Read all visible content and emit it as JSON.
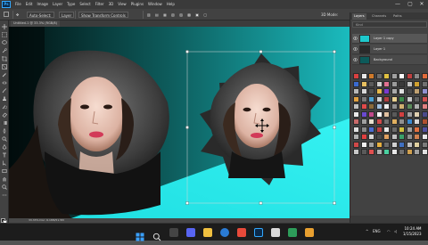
{
  "menubar": {
    "logo": "Ps",
    "items": [
      "File",
      "Edit",
      "Image",
      "Layer",
      "Type",
      "Select",
      "Filter",
      "3D",
      "View",
      "Plugins",
      "Window",
      "Help"
    ],
    "minimize": "—",
    "maximize": "▢",
    "close": "✕"
  },
  "options": {
    "auto_select": "Auto-Select:",
    "layer_value": "Layer",
    "show_transform": "Show Transform Controls",
    "mode_3d": "3D Mode:"
  },
  "document": {
    "tab_label": "Untitled-1 @ 33.3% (RGB/8)",
    "status_text": "33.33%   Doc: 6.18M/51.5M"
  },
  "panels": {
    "tabs": [
      "Layers",
      "Channels",
      "Paths"
    ],
    "search_placeholder": "Kind",
    "layers": [
      {
        "name": "Layer 1 copy"
      },
      {
        "name": "Layer 1"
      },
      {
        "name": "Background"
      }
    ]
  },
  "palette_colors": [
    "#d94040",
    "#e8e8e8",
    "#d07a2a",
    "#6a6a6a",
    "#e0c040",
    "#a0a0a0",
    "#ffffff",
    "#c04040",
    "#8a8a8a",
    "#e06a3a",
    "#3a6ad0",
    "#e8c060",
    "#5a5a5a",
    "#d0d0d0",
    "#e07090",
    "#9a9a9a",
    "#3a3a3a",
    "#c0c0c0",
    "#d0a030",
    "#707070",
    "#b8b8b8",
    "#d8d8d8",
    "#505050",
    "#e6b84a",
    "#7a3ad0",
    "#aaaaaa",
    "#e0e0e0",
    "#4a4a4a",
    "#c0a070",
    "#9090d0",
    "#e0a040",
    "#7a7a7a",
    "#4aa0d0",
    "#d0d0d0",
    "#b04040",
    "#e8d090",
    "#3a8a4a",
    "#c8c8c8",
    "#606060",
    "#d05050",
    "#c0c0c0",
    "#e04a4a",
    "#8a6a3a",
    "#a0c0e0",
    "#f0f0f0",
    "#909090",
    "#d0b070",
    "#5a8a5a",
    "#b0b0b0",
    "#e08080",
    "#e8e8e8",
    "#6a4ad0",
    "#c04a8a",
    "#ffffff",
    "#e0c0a0",
    "#5a5a5a",
    "#d04040",
    "#a0a0a0",
    "#e0d0b0",
    "#4a4a8a",
    "#c86a6a",
    "#a0a0a0",
    "#e8e0d0",
    "#d04a4a",
    "#707070",
    "#e0b060",
    "#909090",
    "#3a8ad0",
    "#d8d8d8",
    "#b05030",
    "#e0e0e0",
    "#8a8a8a",
    "#4a6ad0",
    "#c04040",
    "#e8e8e8",
    "#6a6a6a",
    "#d0c040",
    "#a0a0a0",
    "#e07040",
    "#5050a0",
    "#b0b0b0",
    "#e04040",
    "#d8d8d8",
    "#4a4a4a",
    "#e0a060",
    "#c0c0c0",
    "#3aa06a",
    "#909090",
    "#d08050",
    "#e8e8e8",
    "#d04848",
    "#f0f0f0",
    "#a0a0a0",
    "#e8b040",
    "#6a6a6a",
    "#d0d0d0",
    "#4070c0",
    "#c0c0c0",
    "#e0d0a0",
    "#7a7a7a",
    "#c8c8c8",
    "#5a5a5a",
    "#e05050",
    "#b0b0b0",
    "#4ad0a0",
    "#e8e8e8",
    "#707070",
    "#d0a050",
    "#a0a0a0",
    "#e0e0e0"
  ],
  "taskbar": {
    "time": "10:24 AM",
    "date": "1/15/2023",
    "lang": "ENG"
  },
  "colors": {
    "teal": "#1ec8cc",
    "cyan": "#27e8ea",
    "ps_blue": "#31a8ff"
  }
}
